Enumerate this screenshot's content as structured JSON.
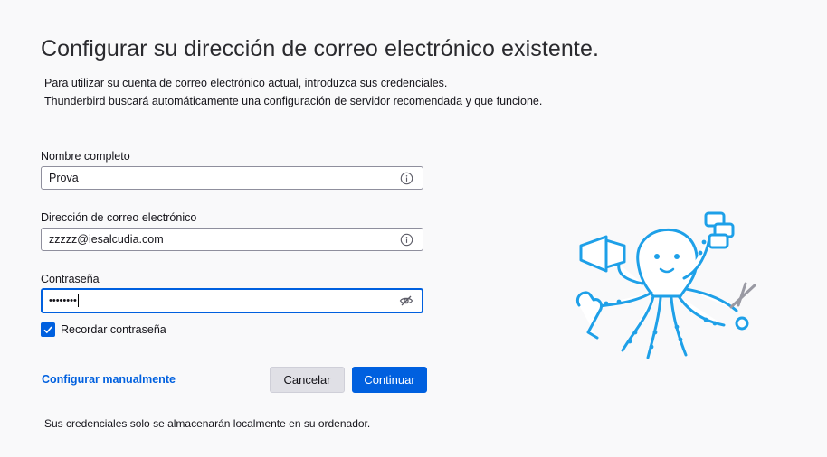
{
  "header": {
    "title": "Configurar su dirección de correo electrónico existente.",
    "subtitle_line1": "Para utilizar su cuenta de correo electrónico actual, introduzca sus credenciales.",
    "subtitle_line2": "Thunderbird buscará automáticamente una configuración de servidor recomendada y que funcione."
  },
  "form": {
    "fullname": {
      "label": "Nombre completo",
      "value": "Prova",
      "icon": "info-icon"
    },
    "email": {
      "label": "Dirección de correo electrónico",
      "value": "zzzzz@iesalcudia.com",
      "icon": "info-icon"
    },
    "password": {
      "label": "Contraseña",
      "value": "••••••••",
      "icon": "eye-slash-icon"
    },
    "remember": {
      "label": "Recordar contraseña",
      "checked": true
    }
  },
  "actions": {
    "manual_config": "Configurar manualmente",
    "cancel": "Cancelar",
    "continue": "Continuar"
  },
  "footer": {
    "note": "Sus credenciales solo se almacenarán localmente en su ordenador."
  },
  "colors": {
    "accent": "#0060df",
    "mascot": "#1ea0e8",
    "background": "#f9f9fa"
  }
}
